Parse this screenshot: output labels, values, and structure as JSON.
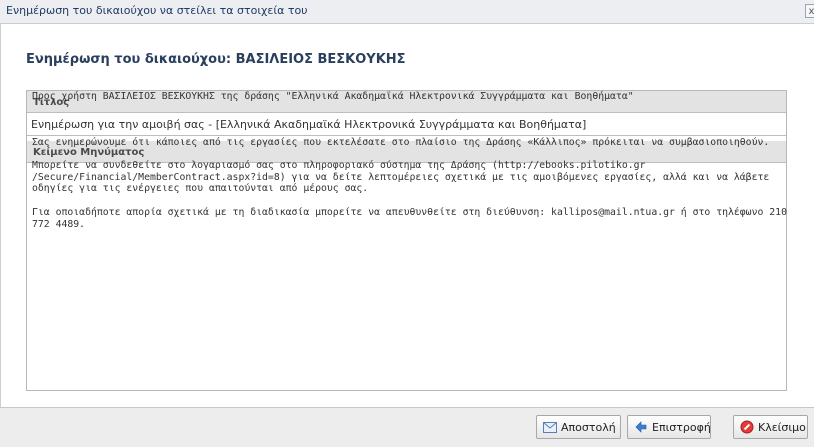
{
  "window": {
    "title": "Ενημέρωση του δικαιούχου να στείλει τα στοιχεία του",
    "close_label": "x"
  },
  "header": {
    "title": "Ενημέρωση του δικαιούχου: ΒΑΣΙΛΕΙΟΣ ΒΕΣΚΟΥΚΗΣ"
  },
  "form": {
    "title_label": "Τίτλος",
    "title_value": "Ενημέρωση για την αμοιβή σας - [Ελληνικά Ακαδημαϊκά Ηλεκτρονικά Συγγράμματα και Βοηθήματα]",
    "message_label": "Κείμενο Μηνύματος",
    "message": {
      "p1": "Προς χρήστη ΒΑΣΙΛΕΙΟΣ ΒΕΣΚΟΥΚΗΣ της δράσης \"Ελληνικά Ακαδημαϊκά Ηλεκτρονικά Συγγράμματα και Βοηθήματα\"",
      "p2": "Σας ενημερώνουμε ότι κάποιες από τις εργασίες που εκτελέσατε στο πλαίσιο της Δράσης «Κάλλιπος» πρόκειται να συμβασιοποιηθούν.",
      "p3": "Μπορείτε να συνδεθείτε στο λογαριασμό σας στο πληροφοριακό σύστημα της Δράσης (http://ebooks.pilotiko.gr /Secure/Financial/MemberContract.aspx?id=8) για να δείτε λεπτομέρειες σχετικά με τις αμοιβόμενες εργασίες, αλλά και να λάβετε οδηγίες για τις ενέργειες που απαιτούνται από μέρους σας.",
      "p4": "Για οποιαδήποτε απορία σχετικά με τη διαδικασία μπορείτε να απευθυνθείτε στη διεύθυνση: kallipos@mail.ntua.gr ή στο τηλέφωνο 210 772 4489."
    }
  },
  "buttons": {
    "send": "Αποστολή",
    "back": "Επιστροφή",
    "close": "Κλείσιμο"
  },
  "colors": {
    "header_text": "#2a3f5d",
    "section_bg": "#e3e3e3",
    "footer_bg": "#ededed",
    "close_icon": "#e23b3b",
    "back_icon": "#3b7fd0"
  },
  "icons": {
    "send": "envelope-icon",
    "back": "back-arrow-icon",
    "close": "no-entry-icon"
  }
}
